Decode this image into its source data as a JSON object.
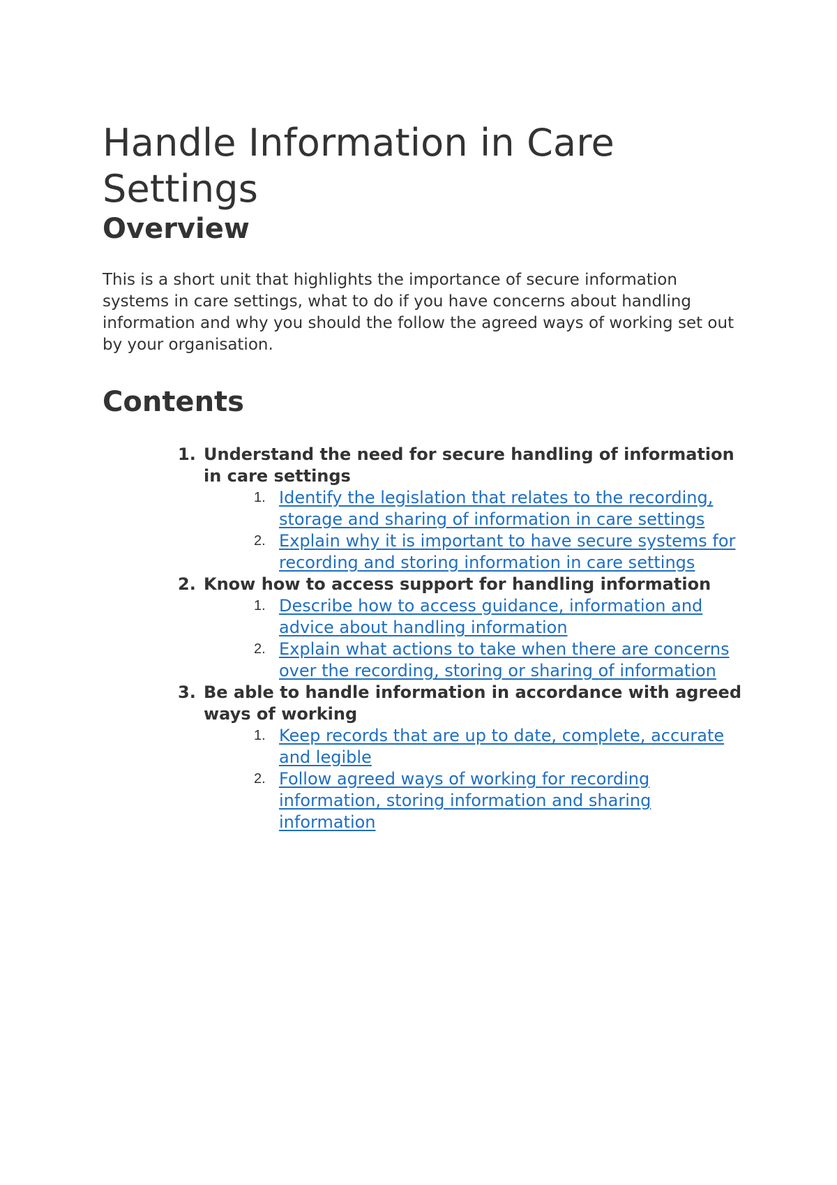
{
  "document": {
    "title": "Handle Information in Care Settings",
    "overview_heading": "Overview",
    "overview_text": "This is a short unit that highlights the importance of secure information systems in care settings, what to do if you have concerns about handling information and why you should the follow the agreed ways of working set out by your organisation.",
    "contents_heading": "Contents",
    "link_color": "#1f6fc1",
    "text_color": "#333333",
    "contents": [
      {
        "number": "1.",
        "label": "Understand the need for secure handling of information in care settings",
        "items": [
          {
            "number": "1.",
            "label": "Identify the legislation that relates to the recording, storage and sharing of information in care settings"
          },
          {
            "number": "2.",
            "label": "Explain why it is important to have secure systems for recording and storing information in care settings"
          }
        ]
      },
      {
        "number": "2.",
        "label": "Know how to access support for handling information",
        "items": [
          {
            "number": "1.",
            "label": "Describe how to access guidance, information and advice about handling information"
          },
          {
            "number": "2.",
            "label": "Explain what actions to take when there are concerns over the recording, storing or sharing of information"
          }
        ]
      },
      {
        "number": "3.",
        "label": "Be able to handle information in accordance with agreed ways of working",
        "items": [
          {
            "number": "1.",
            "label": "Keep records that are up to date, complete, accurate and legible"
          },
          {
            "number": "2.",
            "label": "Follow agreed ways of working for recording information, storing information and sharing information"
          }
        ]
      }
    ]
  }
}
